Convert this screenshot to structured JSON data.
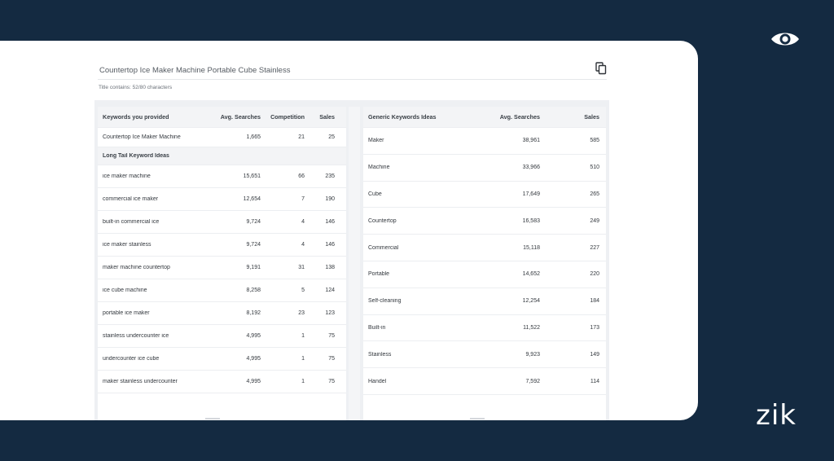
{
  "brand": {
    "logo_text": "zik"
  },
  "title": {
    "value": "Countertop Ice Maker Machine Portable Cube Stainless",
    "char_count": "Title contains: 52/80 characters"
  },
  "left_table": {
    "headers": [
      "Keywords you provided",
      "Avg. Searches",
      "Competition",
      "Sales"
    ],
    "provided": [
      {
        "keyword": "Countertop Ice Maker Machine",
        "avg": "1,665",
        "comp": "21",
        "sales": "25"
      }
    ],
    "section_label": "Long Tail Keyword Ideas",
    "rows": [
      {
        "keyword": "ice maker machine",
        "avg": "15,651",
        "comp": "66",
        "sales": "235"
      },
      {
        "keyword": "commercial ice maker",
        "avg": "12,654",
        "comp": "7",
        "sales": "190"
      },
      {
        "keyword": "built-in commercial ice",
        "avg": "9,724",
        "comp": "4",
        "sales": "146"
      },
      {
        "keyword": "ice maker stainless",
        "avg": "9,724",
        "comp": "4",
        "sales": "146"
      },
      {
        "keyword": "maker machine countertop",
        "avg": "9,191",
        "comp": "31",
        "sales": "138"
      },
      {
        "keyword": "ice cube machine",
        "avg": "8,258",
        "comp": "5",
        "sales": "124"
      },
      {
        "keyword": "portable ice maker",
        "avg": "8,192",
        "comp": "23",
        "sales": "123"
      },
      {
        "keyword": "stainless undercounter ice",
        "avg": "4,995",
        "comp": "1",
        "sales": "75"
      },
      {
        "keyword": "undercounter ice cube",
        "avg": "4,995",
        "comp": "1",
        "sales": "75"
      },
      {
        "keyword": "maker stainless undercounter",
        "avg": "4,995",
        "comp": "1",
        "sales": "75"
      }
    ]
  },
  "right_table": {
    "headers": [
      "Generic Keywords Ideas",
      "Avg. Searches",
      "Sales"
    ],
    "rows": [
      {
        "keyword": "Maker",
        "avg": "38,961",
        "sales": "585"
      },
      {
        "keyword": "Machine",
        "avg": "33,966",
        "sales": "510"
      },
      {
        "keyword": "Cube",
        "avg": "17,649",
        "sales": "265"
      },
      {
        "keyword": "Countertop",
        "avg": "16,583",
        "sales": "249"
      },
      {
        "keyword": "Commercial",
        "avg": "15,118",
        "sales": "227"
      },
      {
        "keyword": "Portable",
        "avg": "14,652",
        "sales": "220"
      },
      {
        "keyword": "Self-cleaning",
        "avg": "12,254",
        "sales": "184"
      },
      {
        "keyword": "Built-in",
        "avg": "11,522",
        "sales": "173"
      },
      {
        "keyword": "Stainless",
        "avg": "9,923",
        "sales": "149"
      },
      {
        "keyword": "Handel",
        "avg": "7,592",
        "sales": "114"
      }
    ]
  }
}
